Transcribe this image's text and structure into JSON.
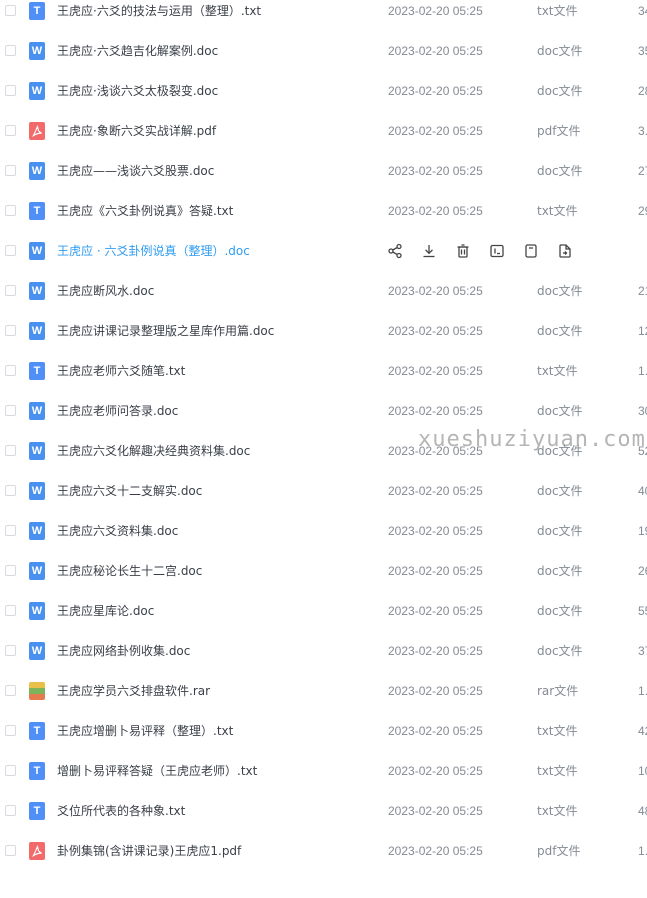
{
  "files": [
    {
      "name": "王虎应·六爻的技法与运用（整理）.txt",
      "date": "2023-02-20 05:25",
      "type": "txt文件",
      "size": "34",
      "icon": "txt"
    },
    {
      "name": "王虎应·六爻趋吉化解案例.doc",
      "date": "2023-02-20 05:25",
      "type": "doc文件",
      "size": "35",
      "icon": "doc"
    },
    {
      "name": "王虎应·浅谈六爻太极裂变.doc",
      "date": "2023-02-20 05:25",
      "type": "doc文件",
      "size": "28",
      "icon": "doc"
    },
    {
      "name": "王虎应·象断六爻实战详解.pdf",
      "date": "2023-02-20 05:25",
      "type": "pdf文件",
      "size": "3.",
      "icon": "pdf"
    },
    {
      "name": "王虎应——浅谈六爻股票.doc",
      "date": "2023-02-20 05:25",
      "type": "doc文件",
      "size": "27",
      "icon": "doc"
    },
    {
      "name": "王虎应《六爻卦例说真》答疑.txt",
      "date": "2023-02-20 05:25",
      "type": "txt文件",
      "size": "29",
      "icon": "txt"
    },
    {
      "name": "王虎应 · 六爻卦例说真（整理）.doc",
      "date": "",
      "type": "",
      "size": "",
      "icon": "doc",
      "hover": true
    },
    {
      "name": "王虎应断风水.doc",
      "date": "2023-02-20 05:25",
      "type": "doc文件",
      "size": "21",
      "icon": "doc"
    },
    {
      "name": "王虎应讲课记录整理版之星库作用篇.doc",
      "date": "2023-02-20 05:25",
      "type": "doc文件",
      "size": "12",
      "icon": "doc"
    },
    {
      "name": "王虎应老师六爻随笔.txt",
      "date": "2023-02-20 05:25",
      "type": "txt文件",
      "size": "1.",
      "icon": "txt"
    },
    {
      "name": "王虎应老师问答录.doc",
      "date": "2023-02-20 05:25",
      "type": "doc文件",
      "size": "30",
      "icon": "doc"
    },
    {
      "name": "王虎应六爻化解趣决经典资料集.doc",
      "date": "2023-02-20 05:25",
      "type": "doc文件",
      "size": "52",
      "icon": "doc"
    },
    {
      "name": "王虎应六爻十二支解实.doc",
      "date": "2023-02-20 05:25",
      "type": "doc文件",
      "size": "40",
      "icon": "doc"
    },
    {
      "name": "王虎应六爻资料集.doc",
      "date": "2023-02-20 05:25",
      "type": "doc文件",
      "size": "19",
      "icon": "doc"
    },
    {
      "name": "王虎应秘论长生十二宫.doc",
      "date": "2023-02-20 05:25",
      "type": "doc文件",
      "size": "26",
      "icon": "doc"
    },
    {
      "name": "王虎应星库论.doc",
      "date": "2023-02-20 05:25",
      "type": "doc文件",
      "size": "55",
      "icon": "doc"
    },
    {
      "name": "王虎应网络卦例收集.doc",
      "date": "2023-02-20 05:25",
      "type": "doc文件",
      "size": "37",
      "icon": "doc"
    },
    {
      "name": "王虎应学员六爻排盘软件.rar",
      "date": "2023-02-20 05:25",
      "type": "rar文件",
      "size": "1.",
      "icon": "rar"
    },
    {
      "name": "王虎应增删卜易评释（整理）.txt",
      "date": "2023-02-20 05:25",
      "type": "txt文件",
      "size": "42",
      "icon": "txt"
    },
    {
      "name": "增删卜易评释答疑（王虎应老师）.txt",
      "date": "2023-02-20 05:25",
      "type": "txt文件",
      "size": "10",
      "icon": "txt"
    },
    {
      "name": "爻位所代表的各种象.txt",
      "date": "2023-02-20 05:25",
      "type": "txt文件",
      "size": "48",
      "icon": "txt"
    },
    {
      "name": "卦例集锦(含讲课记录)王虎应1.pdf",
      "date": "2023-02-20 05:25",
      "type": "pdf文件",
      "size": "1.",
      "icon": "pdf"
    }
  ],
  "icon_glyphs": {
    "txt": "T",
    "doc": "W",
    "pdf": "",
    "rar": ""
  },
  "row_actions": [
    {
      "name": "share-icon"
    },
    {
      "name": "download-icon"
    },
    {
      "name": "delete-icon"
    },
    {
      "name": "rename-icon"
    },
    {
      "name": "copy-icon"
    },
    {
      "name": "move-icon"
    }
  ],
  "watermark": "xueshuziyuan.com",
  "colors": {
    "hover_text": "#2e9cf2",
    "doc_icon": "#4a90f0",
    "txt_icon": "#4f8ff7",
    "pdf_icon": "#f26a6a"
  }
}
